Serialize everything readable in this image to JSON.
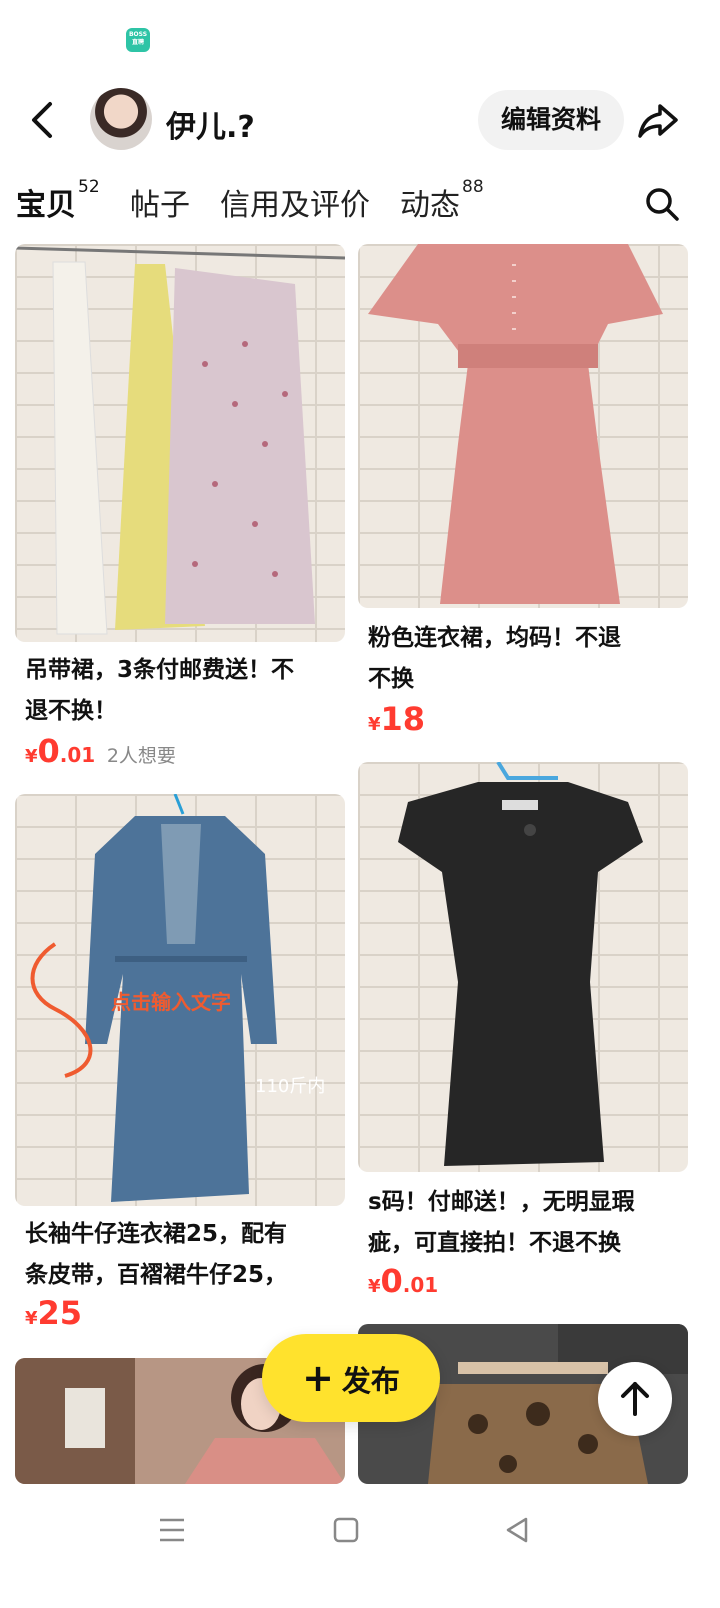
{
  "status_bar": {
    "badge_text": "BOSS直聘"
  },
  "header": {
    "username": "伊儿.?",
    "edit_label": "编辑资料"
  },
  "tabs": [
    {
      "label": "宝贝",
      "count": "52"
    },
    {
      "label": "帖子",
      "count": ""
    },
    {
      "label": "信用及评价",
      "count": ""
    },
    {
      "label": "动态",
      "count": "88"
    }
  ],
  "items": [
    {
      "title_line1": "吊带裙，3条付邮费送！不",
      "title_line2": "退不换！",
      "price_yen": "¥",
      "price_int": "0",
      "price_dec": ".01",
      "wants": "2人想要"
    },
    {
      "title_line1": "粉色连衣裙，均码！不退",
      "title_line2": "不换",
      "price_yen": "¥",
      "price_int": "18",
      "price_dec": ""
    },
    {
      "title_line1": "长袖牛仔连衣裙25，配有",
      "title_line2": "条皮带，百褶裙牛仔25，",
      "price_yen": "¥",
      "price_int": "25",
      "price_dec": "",
      "overlay_text": "点击输入文字",
      "overlay_weight": "110斤内"
    },
    {
      "title_line1": "s码！付邮送！，无明显瑕",
      "title_line2": "疵，可直接拍！不退不换",
      "price_yen": "¥",
      "price_int": "0",
      "price_dec": ".01"
    }
  ],
  "publish_label": "发布",
  "colors": {
    "accent_yellow": "#ffe22d",
    "price_red": "#ff3b30"
  }
}
